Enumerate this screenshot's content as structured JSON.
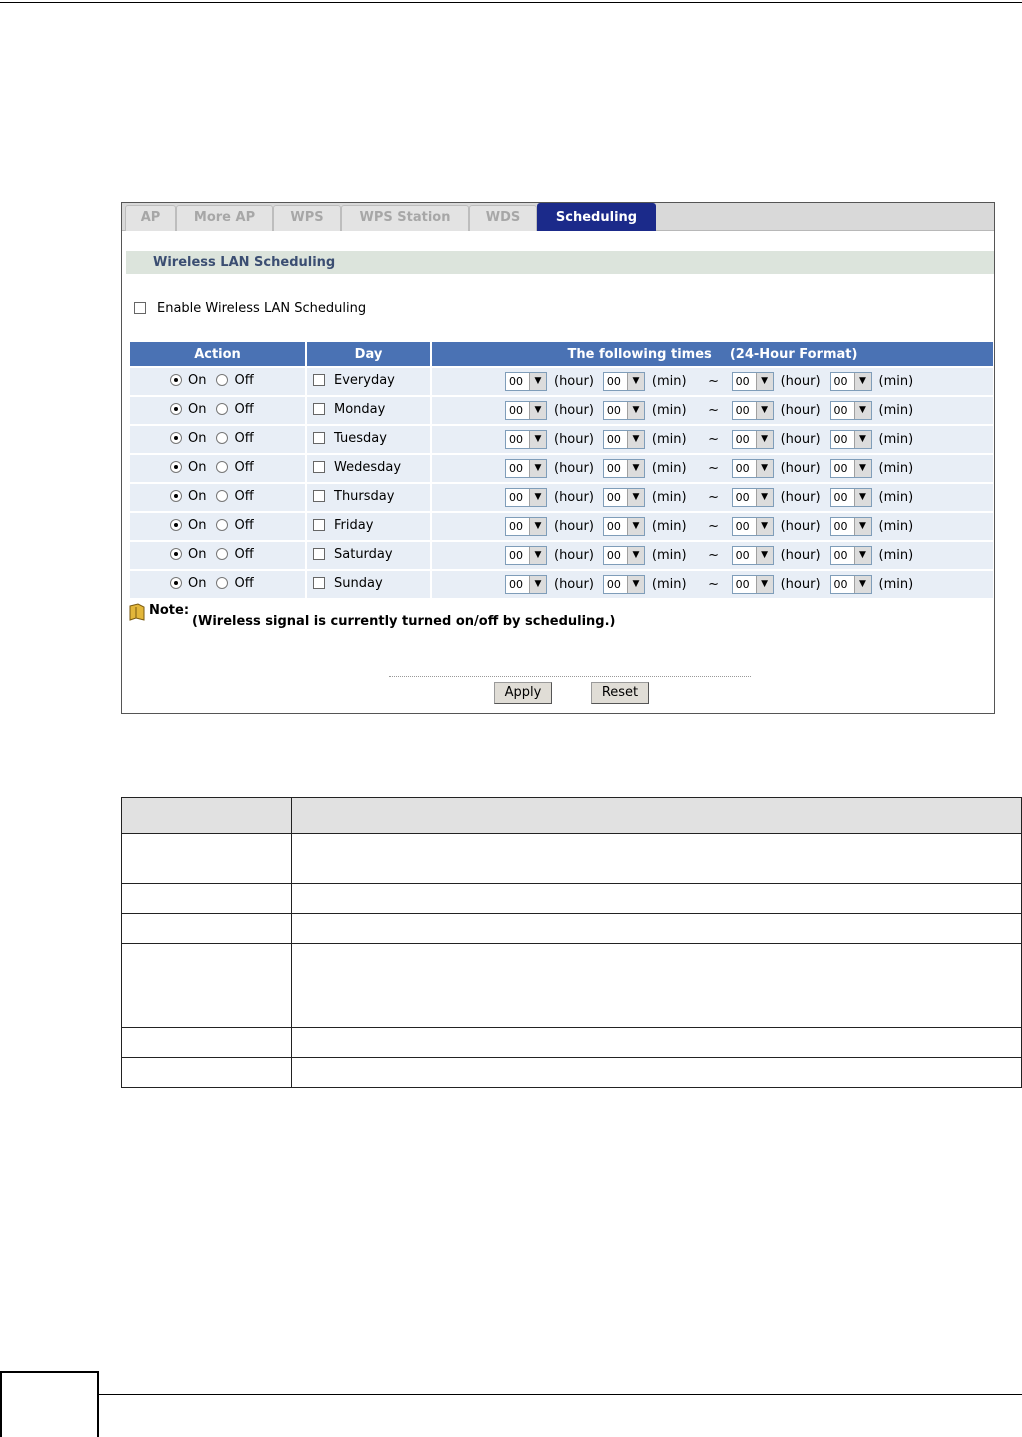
{
  "tabs": [
    {
      "label": "AP"
    },
    {
      "label": "More AP"
    },
    {
      "label": "WPS"
    },
    {
      "label": "WPS Station"
    },
    {
      "label": "WDS"
    },
    {
      "label": "Scheduling",
      "active": true
    }
  ],
  "section_title": "Wireless LAN Scheduling",
  "enable_label": "Enable Wireless LAN Scheduling",
  "enable_checked": false,
  "table_headers": {
    "action": "Action",
    "day": "Day",
    "times": "The following times    (24-Hour Format)"
  },
  "labels": {
    "on": "On",
    "off": "Off",
    "hour": "(hour)",
    "min": "(min)",
    "tilde": "~"
  },
  "rows": [
    {
      "day": "Everyday",
      "action": "on",
      "start_hour": "00",
      "start_min": "00",
      "end_hour": "00",
      "end_min": "00"
    },
    {
      "day": "Monday",
      "action": "on",
      "start_hour": "00",
      "start_min": "00",
      "end_hour": "00",
      "end_min": "00"
    },
    {
      "day": "Tuesday",
      "action": "on",
      "start_hour": "00",
      "start_min": "00",
      "end_hour": "00",
      "end_min": "00"
    },
    {
      "day": "Wedesday",
      "action": "on",
      "start_hour": "00",
      "start_min": "00",
      "end_hour": "00",
      "end_min": "00"
    },
    {
      "day": "Thursday",
      "action": "on",
      "start_hour": "00",
      "start_min": "00",
      "end_hour": "00",
      "end_min": "00"
    },
    {
      "day": "Friday",
      "action": "on",
      "start_hour": "00",
      "start_min": "00",
      "end_hour": "00",
      "end_min": "00"
    },
    {
      "day": "Saturday",
      "action": "on",
      "start_hour": "00",
      "start_min": "00",
      "end_hour": "00",
      "end_min": "00"
    },
    {
      "day": "Sunday",
      "action": "on",
      "start_hour": "00",
      "start_min": "00",
      "end_hour": "00",
      "end_min": "00"
    }
  ],
  "note_label": "Note:",
  "note_text": "(Wireless signal is currently turned on/off by scheduling.)",
  "buttons": {
    "apply": "Apply",
    "reset": "Reset"
  },
  "icons": {
    "dropdown": "chevron-down-icon",
    "note": "note-icon"
  },
  "colors": {
    "active_tab": "#1b2a8a",
    "header_bg": "#4a72b4",
    "row_bg": "#e8eef6",
    "section_bg": "#dce4dc",
    "section_text": "#3b4e72"
  }
}
